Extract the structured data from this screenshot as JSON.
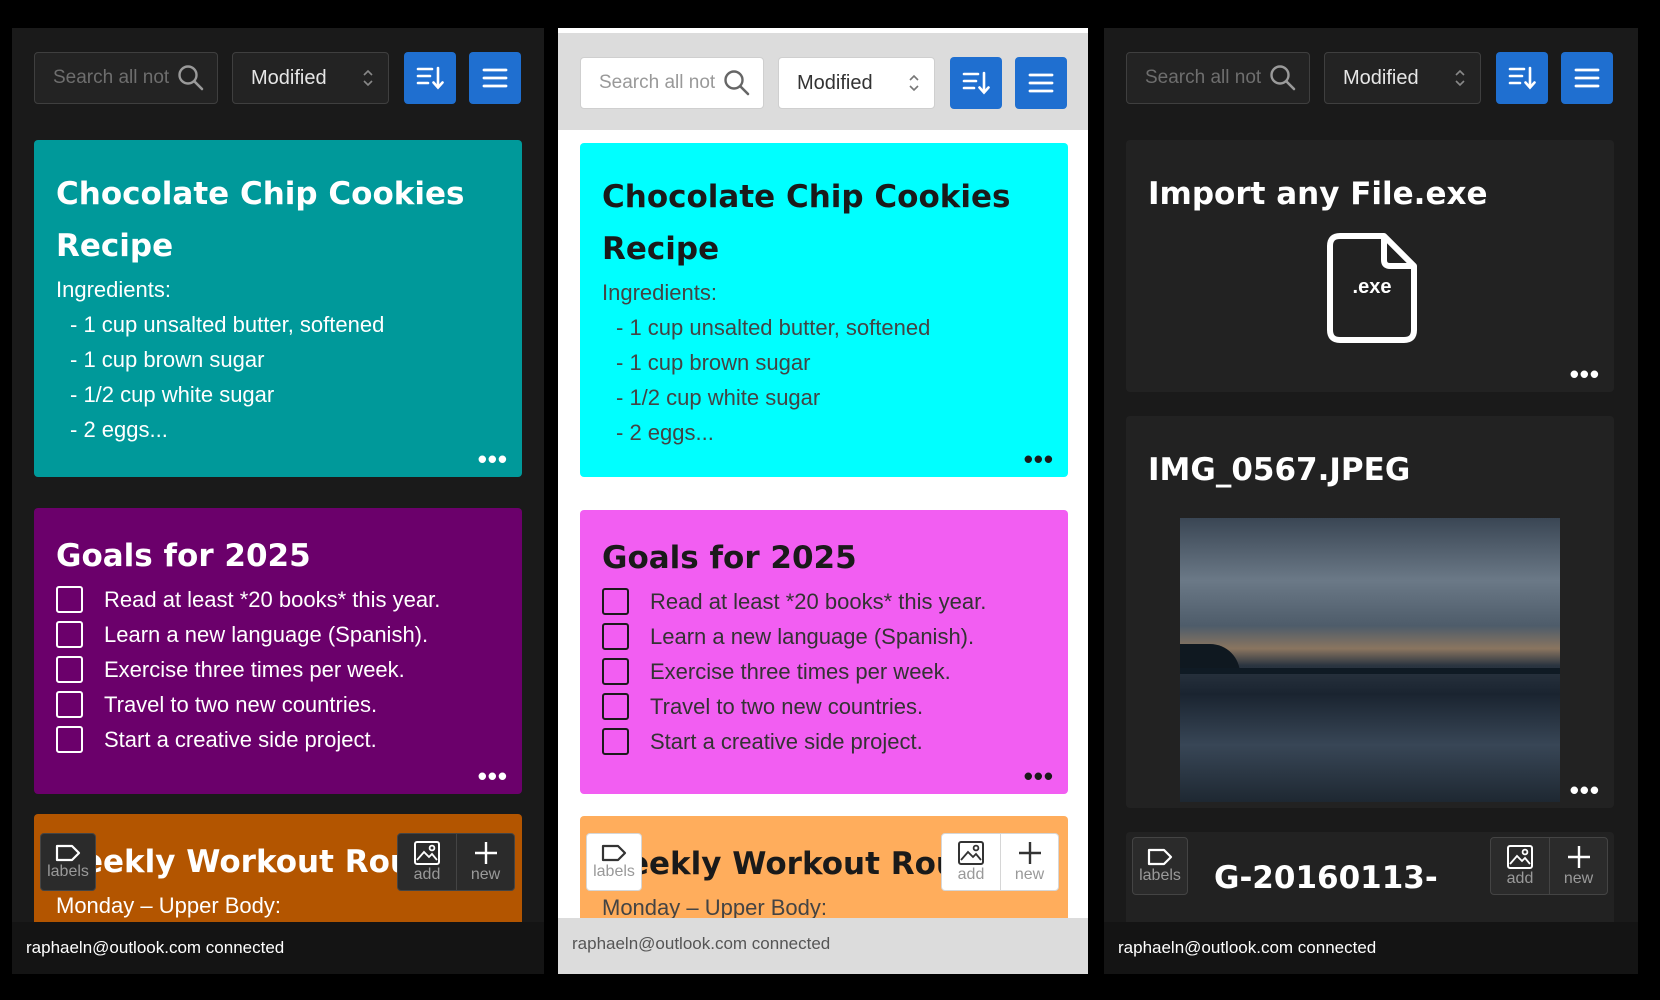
{
  "toolbar": {
    "search_placeholder": "Search all not",
    "sort_value": "Modified"
  },
  "notes": {
    "recipe": {
      "title": "Chocolate Chip Cookies Recipe",
      "ingredients_label": "Ingredients:",
      "items": [
        "- 1 cup unsalted butter, softened",
        "- 1 cup brown sugar",
        "- 1/2 cup white sugar",
        "- 2 eggs..."
      ]
    },
    "goals": {
      "title": "Goals for 2025",
      "items": [
        "Read at least *20 books* this year.",
        "Learn a new language (Spanish).",
        "Exercise three times per week.",
        "Travel to two new countries.",
        "Start a creative side project."
      ]
    },
    "workout": {
      "title_visible": "eekly Workout Rou",
      "subtitle": "Monday – Upper Body:"
    },
    "import": {
      "title": "Import any File.exe",
      "file_label": ".exe"
    },
    "image": {
      "title": "IMG_0567.JPEG"
    },
    "partial": {
      "title": "G-20160113-"
    },
    "more": "•••"
  },
  "fabs": {
    "labels": "labels",
    "add": "add",
    "new": "new"
  },
  "status": {
    "text": "raphaeln@outlook.com connected"
  },
  "colors": {
    "accent_blue": "#1f6fd0",
    "dark_recipe": "#00999a",
    "light_recipe": "#00ffff",
    "dark_goals": "#6b006b",
    "light_goals": "#f25ef2",
    "dark_workout": "#b35500",
    "light_workout": "#ffad5c"
  }
}
